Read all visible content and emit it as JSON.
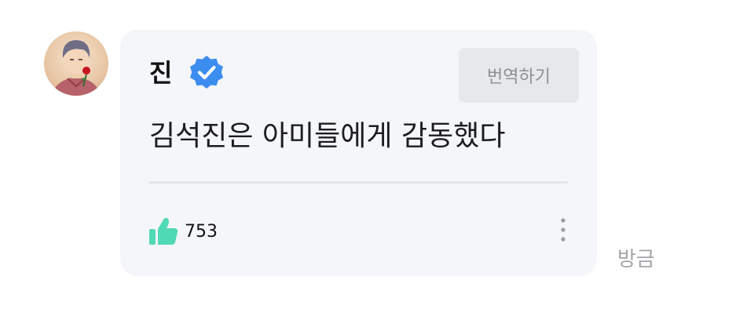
{
  "comment": {
    "author": "진",
    "verified_icon": "verified-badge-icon",
    "translate_label": "번역하기",
    "message": "김석진은 아미들에게 감동했다",
    "like_icon": "thumbs-up-icon",
    "likes": "753",
    "more_icon": "more-vertical-icon",
    "timestamp": "방금"
  },
  "colors": {
    "card_bg": "#f4f6f9",
    "verified_badge": "#3d8df0",
    "like_icon": "#4fd9b4",
    "translate_bg": "#e7e8ea",
    "timestamp": "#a3a5a8"
  }
}
